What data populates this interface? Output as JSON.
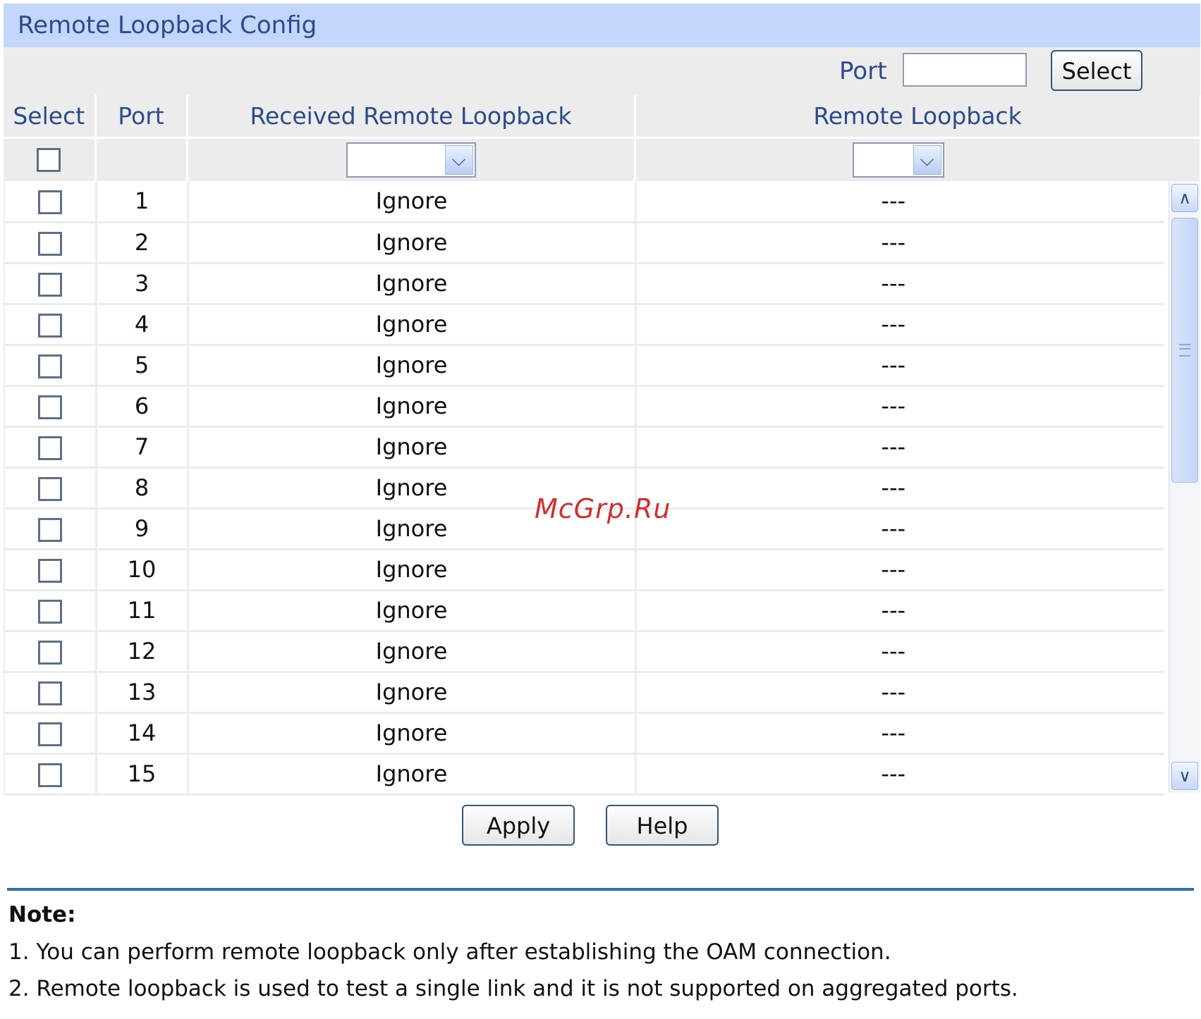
{
  "panel": {
    "title": "Remote Loopback Config"
  },
  "search": {
    "port_label": "Port",
    "port_value": "",
    "select_label": "Select"
  },
  "table": {
    "headers": {
      "select": "Select",
      "port": "Port",
      "received": "Received Remote Loopback",
      "remote": "Remote Loopback"
    },
    "filters": {
      "received_value": "",
      "remote_value": ""
    },
    "rows": [
      {
        "port": "1",
        "received": "Ignore",
        "remote": "---"
      },
      {
        "port": "2",
        "received": "Ignore",
        "remote": "---"
      },
      {
        "port": "3",
        "received": "Ignore",
        "remote": "---"
      },
      {
        "port": "4",
        "received": "Ignore",
        "remote": "---"
      },
      {
        "port": "5",
        "received": "Ignore",
        "remote": "---"
      },
      {
        "port": "6",
        "received": "Ignore",
        "remote": "---"
      },
      {
        "port": "7",
        "received": "Ignore",
        "remote": "---"
      },
      {
        "port": "8",
        "received": "Ignore",
        "remote": "---"
      },
      {
        "port": "9",
        "received": "Ignore",
        "remote": "---"
      },
      {
        "port": "10",
        "received": "Ignore",
        "remote": "---"
      },
      {
        "port": "11",
        "received": "Ignore",
        "remote": "---"
      },
      {
        "port": "12",
        "received": "Ignore",
        "remote": "---"
      },
      {
        "port": "13",
        "received": "Ignore",
        "remote": "---"
      },
      {
        "port": "14",
        "received": "Ignore",
        "remote": "---"
      },
      {
        "port": "15",
        "received": "Ignore",
        "remote": "---"
      }
    ]
  },
  "actions": {
    "apply_label": "Apply",
    "help_label": "Help"
  },
  "note": {
    "title": "Note:",
    "lines": [
      "1. You can perform remote loopback only after establishing the OAM connection.",
      "2. Remote loopback is used to test a single link and it is not supported on aggregated ports."
    ]
  },
  "watermark": "McGrp.Ru",
  "colors": {
    "title_bar": "#c3d6fb",
    "header_text": "#2b4b8c",
    "divider": "#2d6db1",
    "watermark": "#d12f2f"
  }
}
